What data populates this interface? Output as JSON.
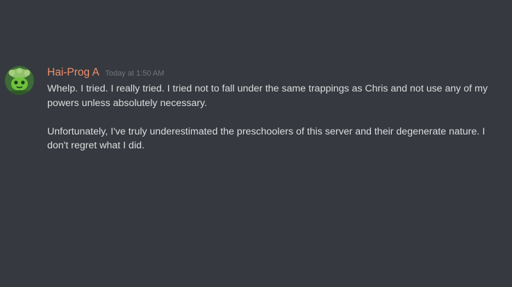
{
  "message": {
    "author": "Hai-Prog A",
    "timestamp": "Today at 1:50 AM",
    "author_color": "#f0906d",
    "avatar_icon": "green-character-avatar",
    "paragraphs": [
      "Whelp. I tried. I really tried. I tried not to fall under the same trappings as Chris and not use any of my powers unless absolutely necessary.",
      "Unfortunately, I've truly underestimated the preschoolers of this server and their degenerate nature. I don't regret what I did."
    ]
  },
  "theme": {
    "background": "#36393f",
    "text": "#dcddde",
    "muted": "#72767d"
  }
}
